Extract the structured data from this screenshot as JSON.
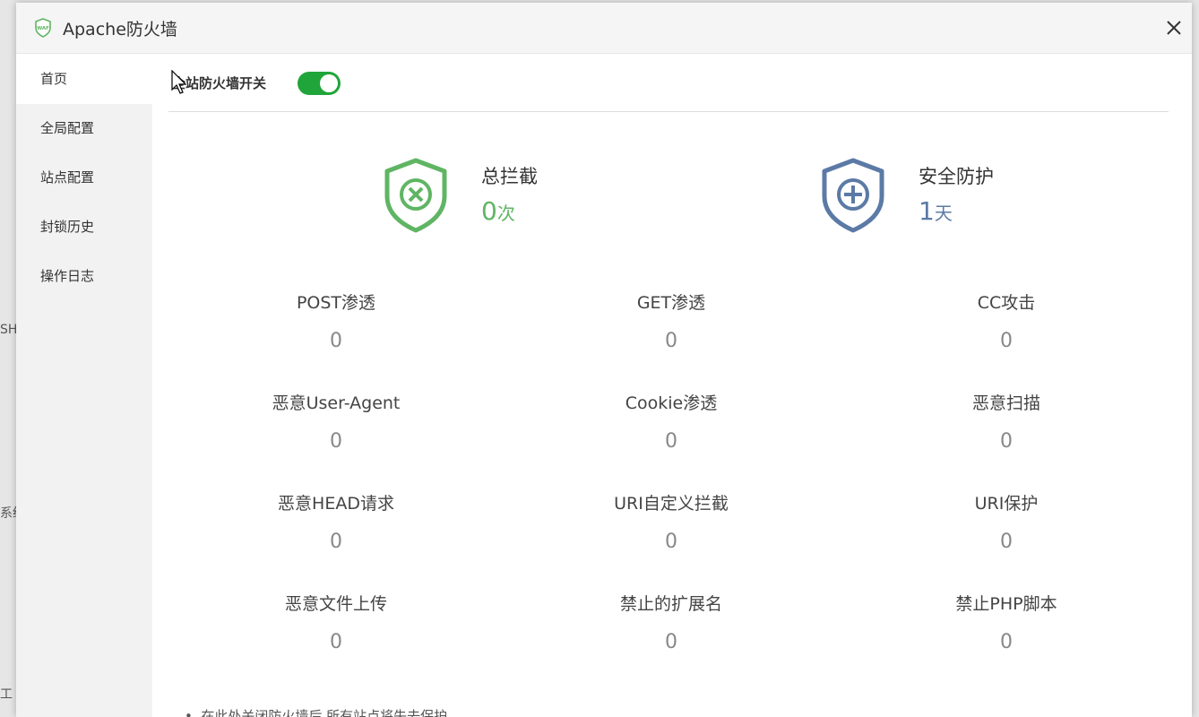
{
  "window": {
    "title": "Apache防火墙",
    "logo_text": "WAF"
  },
  "sidebar": {
    "items": [
      {
        "label": "首页"
      },
      {
        "label": "全局配置"
      },
      {
        "label": "站点配置"
      },
      {
        "label": "封锁历史"
      },
      {
        "label": "操作日志"
      }
    ]
  },
  "switch": {
    "label": "全站防火墙开关",
    "on": true
  },
  "summary": {
    "total": {
      "label": "总拦截",
      "value": "0",
      "unit": "次"
    },
    "protection": {
      "label": "安全防护",
      "value": "1",
      "unit": "天"
    }
  },
  "stats": [
    {
      "label": "POST渗透",
      "value": "0"
    },
    {
      "label": "GET渗透",
      "value": "0"
    },
    {
      "label": "CC攻击",
      "value": "0"
    },
    {
      "label": "恶意User-Agent",
      "value": "0"
    },
    {
      "label": "Cookie渗透",
      "value": "0"
    },
    {
      "label": "恶意扫描",
      "value": "0"
    },
    {
      "label": "恶意HEAD请求",
      "value": "0"
    },
    {
      "label": "URI自定义拦截",
      "value": "0"
    },
    {
      "label": "URI保护",
      "value": "0"
    },
    {
      "label": "恶意文件上传",
      "value": "0"
    },
    {
      "label": "禁止的扩展名",
      "value": "0"
    },
    {
      "label": "禁止PHP脚本",
      "value": "0"
    }
  ],
  "footnote": "在此处关闭防火墙后,所有站点将失去保护",
  "background": {
    "frag1": "SH",
    "frag2": "系统",
    "frag3": "工"
  },
  "colors": {
    "accent_green": "#20a53a",
    "shield_green": "#5fb563",
    "shield_blue": "#5b7aa6"
  }
}
